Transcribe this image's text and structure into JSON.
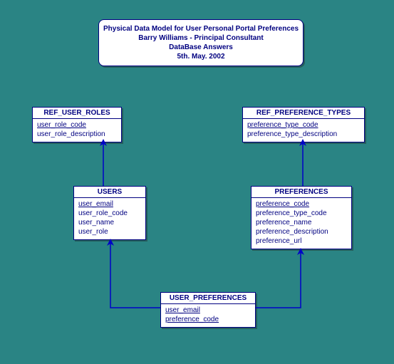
{
  "title": {
    "line1": "Physical Data Model for User Personal Portal Preferences",
    "line2": "Barry Williams - Principal Consultant",
    "line3": "DataBase Answers",
    "line4": "5th. May. 2002"
  },
  "entities": {
    "ref_user_roles": {
      "name": "REF_USER_ROLES",
      "attrs": [
        {
          "text": "user_role_code",
          "pk": true
        },
        {
          "text": "user_role_description",
          "pk": false
        }
      ]
    },
    "ref_preference_types": {
      "name": "REF_PREFERENCE_TYPES",
      "attrs": [
        {
          "text": "preference_type_code",
          "pk": true
        },
        {
          "text": "preference_type_description",
          "pk": false
        }
      ]
    },
    "users": {
      "name": "USERS",
      "attrs": [
        {
          "text": "user_email",
          "pk": true
        },
        {
          "text": "user_role_code",
          "pk": false
        },
        {
          "text": "user_name",
          "pk": false
        },
        {
          "text": "user_role",
          "pk": false
        }
      ]
    },
    "preferences": {
      "name": "PREFERENCES",
      "attrs": [
        {
          "text": "preference_code",
          "pk": true
        },
        {
          "text": "preference_type_code",
          "pk": false
        },
        {
          "text": "preference_name",
          "pk": false
        },
        {
          "text": "preference_description",
          "pk": false
        },
        {
          "text": "preference_url",
          "pk": false
        }
      ]
    },
    "user_preferences": {
      "name": "USER_PREFERENCES",
      "attrs": [
        {
          "text": "user_email",
          "pk": true
        },
        {
          "text": "preference_code",
          "pk": true
        }
      ]
    }
  },
  "relationships": [
    {
      "from": "users",
      "to": "ref_user_roles"
    },
    {
      "from": "preferences",
      "to": "ref_preference_types"
    },
    {
      "from": "user_preferences",
      "to": "users"
    },
    {
      "from": "user_preferences",
      "to": "preferences"
    }
  ]
}
